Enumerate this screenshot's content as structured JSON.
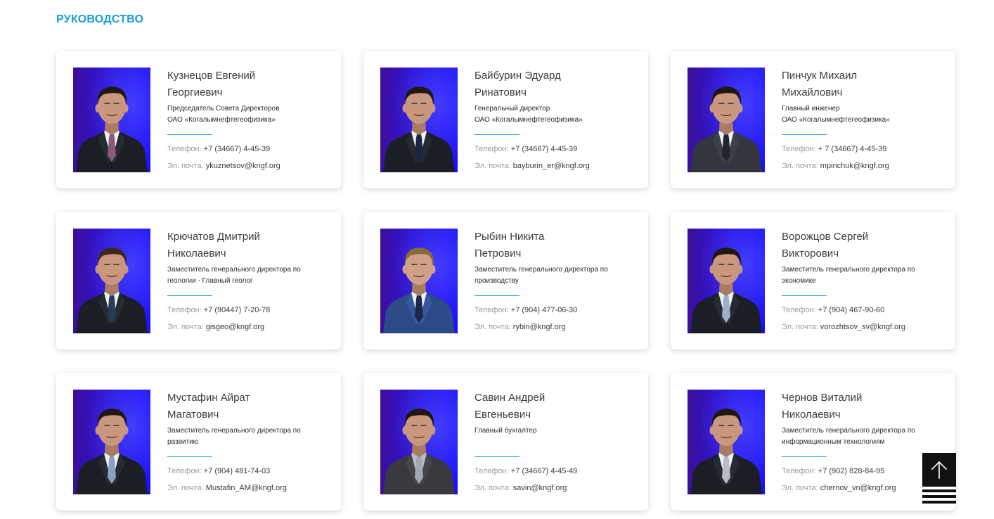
{
  "page": {
    "title": "РУКОВОДСТВО"
  },
  "labels": {
    "phone": "Телефон:",
    "email": "Эл. почта:"
  },
  "colors": {
    "accent": "#1a9dd9",
    "text": "#3d3d3d",
    "muted": "#9a9a9a",
    "back_to_top": "#111111"
  },
  "people": [
    {
      "name_lines": [
        "Кузнецов Евгений",
        "Георгиевич"
      ],
      "role_lines": [
        "Председатель Совета Директоров",
        "ОАО «Когалымнефтегеофизика»"
      ],
      "phone": "+7 (34667) 4-45-39",
      "email": "ykuznetsov@kngf.org"
    },
    {
      "name_lines": [
        "Байбурин Эдуард",
        "Ринатович"
      ],
      "role_lines": [
        "Генеральный директор",
        "ОАО «Когалымнефтегеофизика»"
      ],
      "phone": "+7 (34667) 4-45-39",
      "email": "bayburin_er@kngf.org"
    },
    {
      "name_lines": [
        "Пинчук Михаил",
        "Михайлович"
      ],
      "role_lines": [
        "Главный инженер",
        "ОАО «Когалымнефтегеофизика»"
      ],
      "phone": "+ 7 (34667) 4-45-39",
      "email": "mpinchuk@kngf.org"
    },
    {
      "name_lines": [
        "Крючатов Дмитрий",
        "Николаевич"
      ],
      "role_lines": [
        "Заместитель генерального директора по",
        "геологии - Главный геолог"
      ],
      "phone": "+7 (90447) 7-20-78",
      "email": "gisgeo@kngf.org"
    },
    {
      "name_lines": [
        "Рыбин Никита",
        "Петрович"
      ],
      "role_lines": [
        "Заместитель генерального директора по",
        "производству"
      ],
      "phone": "+7 (904) 477-06-30",
      "email": "rybin@kngf.org"
    },
    {
      "name_lines": [
        "Ворожцов Сергей",
        "Викторович"
      ],
      "role_lines": [
        "Заместитель генерального директора по",
        "экономике"
      ],
      "phone": "+7 (904) 467-90-60",
      "email": "vorozhtsov_sv@kngf.org"
    },
    {
      "name_lines": [
        "Мустафин Айрат",
        "Магатович"
      ],
      "role_lines": [
        "Заместитель генерального директора по",
        "развитию"
      ],
      "phone": "+7 (904) 481-74-03",
      "email": "Mustafin_AM@kngf.org"
    },
    {
      "name_lines": [
        "Савин Андрей",
        "Евгеньевич"
      ],
      "role_lines": [
        "Главный бухгалтер"
      ],
      "phone": "+7 (34667) 4-45-49",
      "email": "savin@kngf.org"
    },
    {
      "name_lines": [
        "Чернов Виталий",
        "Николаевич"
      ],
      "role_lines": [
        "Заместитель генерального директора по",
        "информационным технологиям"
      ],
      "phone": "+7 (902) 828-84-95",
      "email": "chernov_vn@kngf.org"
    }
  ],
  "back_to_top": {
    "icon": "arrow-up-icon"
  }
}
